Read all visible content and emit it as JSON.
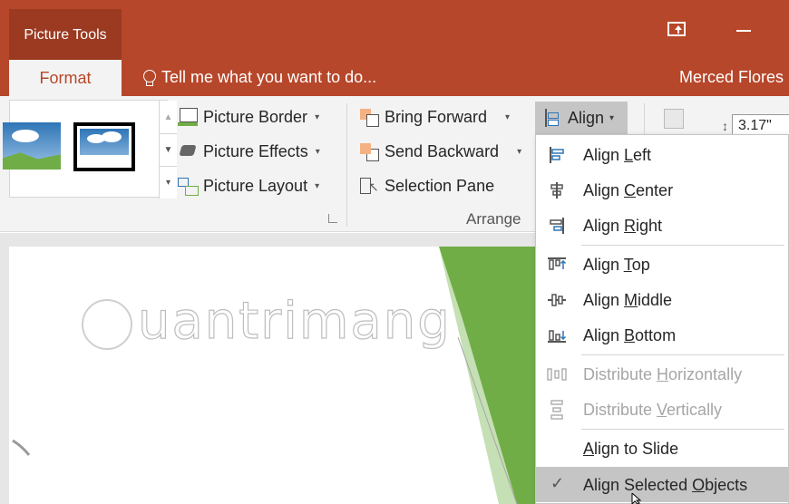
{
  "titlebar": {
    "context_tab": "Picture Tools",
    "restore_icon": "ribbon-display-options-icon",
    "minimize_icon": "minimize-icon"
  },
  "tabs": {
    "active": "Format",
    "tell_me": "Tell me what you want to do...",
    "user": "Merced Flores"
  },
  "ribbon": {
    "picture_border": "Picture Border",
    "picture_effects": "Picture Effects",
    "picture_layout": "Picture Layout",
    "bring_forward": "Bring Forward",
    "send_backward": "Send Backward",
    "selection_pane": "Selection Pane",
    "align": "Align",
    "arrange_label": "Arrange",
    "height_value": "3.17\""
  },
  "align_menu": {
    "items": [
      {
        "pre": "Align ",
        "u": "L",
        "post": "eft",
        "icon": "align-left-icon",
        "enabled": true
      },
      {
        "pre": "Align ",
        "u": "C",
        "post": "enter",
        "icon": "align-center-icon",
        "enabled": true
      },
      {
        "pre": "Align ",
        "u": "R",
        "post": "ight",
        "icon": "align-right-icon",
        "enabled": true
      },
      {
        "pre": "Align ",
        "u": "T",
        "post": "op",
        "icon": "align-top-icon",
        "enabled": true
      },
      {
        "pre": "Align ",
        "u": "M",
        "post": "iddle",
        "icon": "align-middle-icon",
        "enabled": true
      },
      {
        "pre": "Align ",
        "u": "B",
        "post": "ottom",
        "icon": "align-bottom-icon",
        "enabled": true
      },
      {
        "pre": "Distribute ",
        "u": "H",
        "post": "orizontally",
        "icon": "distribute-horizontally-icon",
        "enabled": false
      },
      {
        "pre": "Distribute ",
        "u": "V",
        "post": "ertically",
        "icon": "distribute-vertically-icon",
        "enabled": false
      },
      {
        "pre": "",
        "u": "A",
        "post": "lign to Slide",
        "icon": "",
        "enabled": true
      },
      {
        "pre": "Align Selected ",
        "u": "O",
        "post": "bjects",
        "icon": "checkmark-icon",
        "enabled": true,
        "checked": true
      }
    ]
  },
  "watermark": "uantrimang",
  "colors": {
    "accent": "#b7472a",
    "ribbon_bg": "#f3f3f3",
    "slide_green": "#70ad47"
  }
}
